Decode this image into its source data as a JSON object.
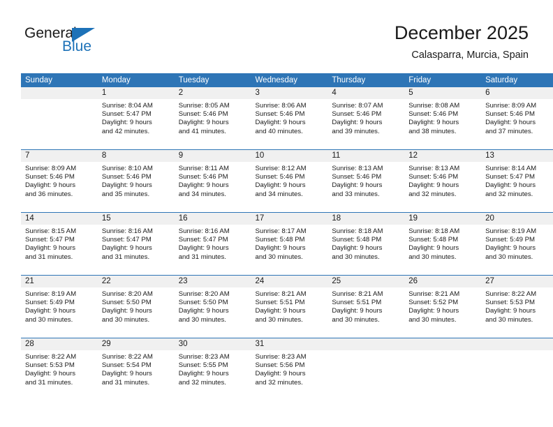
{
  "logo": {
    "word_one": "General",
    "word_two": "Blue",
    "triangle_icon": "triangle-icon"
  },
  "header": {
    "title": "December 2025",
    "subtitle": "Calasparra, Murcia, Spain"
  },
  "colors": {
    "header_blue": "#2e75b6",
    "logo_blue": "#1d72b8",
    "daynum_bg": "#f0f0f0",
    "text": "#1a1a1a"
  },
  "calendar": {
    "weekday_headers": [
      "Sunday",
      "Monday",
      "Tuesday",
      "Wednesday",
      "Thursday",
      "Friday",
      "Saturday"
    ],
    "weeks": [
      [
        {
          "day": "",
          "lines": []
        },
        {
          "day": "1",
          "lines": [
            "Sunrise: 8:04 AM",
            "Sunset: 5:47 PM",
            "Daylight: 9 hours",
            "and 42 minutes."
          ]
        },
        {
          "day": "2",
          "lines": [
            "Sunrise: 8:05 AM",
            "Sunset: 5:46 PM",
            "Daylight: 9 hours",
            "and 41 minutes."
          ]
        },
        {
          "day": "3",
          "lines": [
            "Sunrise: 8:06 AM",
            "Sunset: 5:46 PM",
            "Daylight: 9 hours",
            "and 40 minutes."
          ]
        },
        {
          "day": "4",
          "lines": [
            "Sunrise: 8:07 AM",
            "Sunset: 5:46 PM",
            "Daylight: 9 hours",
            "and 39 minutes."
          ]
        },
        {
          "day": "5",
          "lines": [
            "Sunrise: 8:08 AM",
            "Sunset: 5:46 PM",
            "Daylight: 9 hours",
            "and 38 minutes."
          ]
        },
        {
          "day": "6",
          "lines": [
            "Sunrise: 8:09 AM",
            "Sunset: 5:46 PM",
            "Daylight: 9 hours",
            "and 37 minutes."
          ]
        }
      ],
      [
        {
          "day": "7",
          "lines": [
            "Sunrise: 8:09 AM",
            "Sunset: 5:46 PM",
            "Daylight: 9 hours",
            "and 36 minutes."
          ]
        },
        {
          "day": "8",
          "lines": [
            "Sunrise: 8:10 AM",
            "Sunset: 5:46 PM",
            "Daylight: 9 hours",
            "and 35 minutes."
          ]
        },
        {
          "day": "9",
          "lines": [
            "Sunrise: 8:11 AM",
            "Sunset: 5:46 PM",
            "Daylight: 9 hours",
            "and 34 minutes."
          ]
        },
        {
          "day": "10",
          "lines": [
            "Sunrise: 8:12 AM",
            "Sunset: 5:46 PM",
            "Daylight: 9 hours",
            "and 34 minutes."
          ]
        },
        {
          "day": "11",
          "lines": [
            "Sunrise: 8:13 AM",
            "Sunset: 5:46 PM",
            "Daylight: 9 hours",
            "and 33 minutes."
          ]
        },
        {
          "day": "12",
          "lines": [
            "Sunrise: 8:13 AM",
            "Sunset: 5:46 PM",
            "Daylight: 9 hours",
            "and 32 minutes."
          ]
        },
        {
          "day": "13",
          "lines": [
            "Sunrise: 8:14 AM",
            "Sunset: 5:47 PM",
            "Daylight: 9 hours",
            "and 32 minutes."
          ]
        }
      ],
      [
        {
          "day": "14",
          "lines": [
            "Sunrise: 8:15 AM",
            "Sunset: 5:47 PM",
            "Daylight: 9 hours",
            "and 31 minutes."
          ]
        },
        {
          "day": "15",
          "lines": [
            "Sunrise: 8:16 AM",
            "Sunset: 5:47 PM",
            "Daylight: 9 hours",
            "and 31 minutes."
          ]
        },
        {
          "day": "16",
          "lines": [
            "Sunrise: 8:16 AM",
            "Sunset: 5:47 PM",
            "Daylight: 9 hours",
            "and 31 minutes."
          ]
        },
        {
          "day": "17",
          "lines": [
            "Sunrise: 8:17 AM",
            "Sunset: 5:48 PM",
            "Daylight: 9 hours",
            "and 30 minutes."
          ]
        },
        {
          "day": "18",
          "lines": [
            "Sunrise: 8:18 AM",
            "Sunset: 5:48 PM",
            "Daylight: 9 hours",
            "and 30 minutes."
          ]
        },
        {
          "day": "19",
          "lines": [
            "Sunrise: 8:18 AM",
            "Sunset: 5:48 PM",
            "Daylight: 9 hours",
            "and 30 minutes."
          ]
        },
        {
          "day": "20",
          "lines": [
            "Sunrise: 8:19 AM",
            "Sunset: 5:49 PM",
            "Daylight: 9 hours",
            "and 30 minutes."
          ]
        }
      ],
      [
        {
          "day": "21",
          "lines": [
            "Sunrise: 8:19 AM",
            "Sunset: 5:49 PM",
            "Daylight: 9 hours",
            "and 30 minutes."
          ]
        },
        {
          "day": "22",
          "lines": [
            "Sunrise: 8:20 AM",
            "Sunset: 5:50 PM",
            "Daylight: 9 hours",
            "and 30 minutes."
          ]
        },
        {
          "day": "23",
          "lines": [
            "Sunrise: 8:20 AM",
            "Sunset: 5:50 PM",
            "Daylight: 9 hours",
            "and 30 minutes."
          ]
        },
        {
          "day": "24",
          "lines": [
            "Sunrise: 8:21 AM",
            "Sunset: 5:51 PM",
            "Daylight: 9 hours",
            "and 30 minutes."
          ]
        },
        {
          "day": "25",
          "lines": [
            "Sunrise: 8:21 AM",
            "Sunset: 5:51 PM",
            "Daylight: 9 hours",
            "and 30 minutes."
          ]
        },
        {
          "day": "26",
          "lines": [
            "Sunrise: 8:21 AM",
            "Sunset: 5:52 PM",
            "Daylight: 9 hours",
            "and 30 minutes."
          ]
        },
        {
          "day": "27",
          "lines": [
            "Sunrise: 8:22 AM",
            "Sunset: 5:53 PM",
            "Daylight: 9 hours",
            "and 30 minutes."
          ]
        }
      ],
      [
        {
          "day": "28",
          "lines": [
            "Sunrise: 8:22 AM",
            "Sunset: 5:53 PM",
            "Daylight: 9 hours",
            "and 31 minutes."
          ]
        },
        {
          "day": "29",
          "lines": [
            "Sunrise: 8:22 AM",
            "Sunset: 5:54 PM",
            "Daylight: 9 hours",
            "and 31 minutes."
          ]
        },
        {
          "day": "30",
          "lines": [
            "Sunrise: 8:23 AM",
            "Sunset: 5:55 PM",
            "Daylight: 9 hours",
            "and 32 minutes."
          ]
        },
        {
          "day": "31",
          "lines": [
            "Sunrise: 8:23 AM",
            "Sunset: 5:56 PM",
            "Daylight: 9 hours",
            "and 32 minutes."
          ]
        },
        {
          "day": "",
          "lines": []
        },
        {
          "day": "",
          "lines": []
        },
        {
          "day": "",
          "lines": []
        }
      ]
    ]
  }
}
